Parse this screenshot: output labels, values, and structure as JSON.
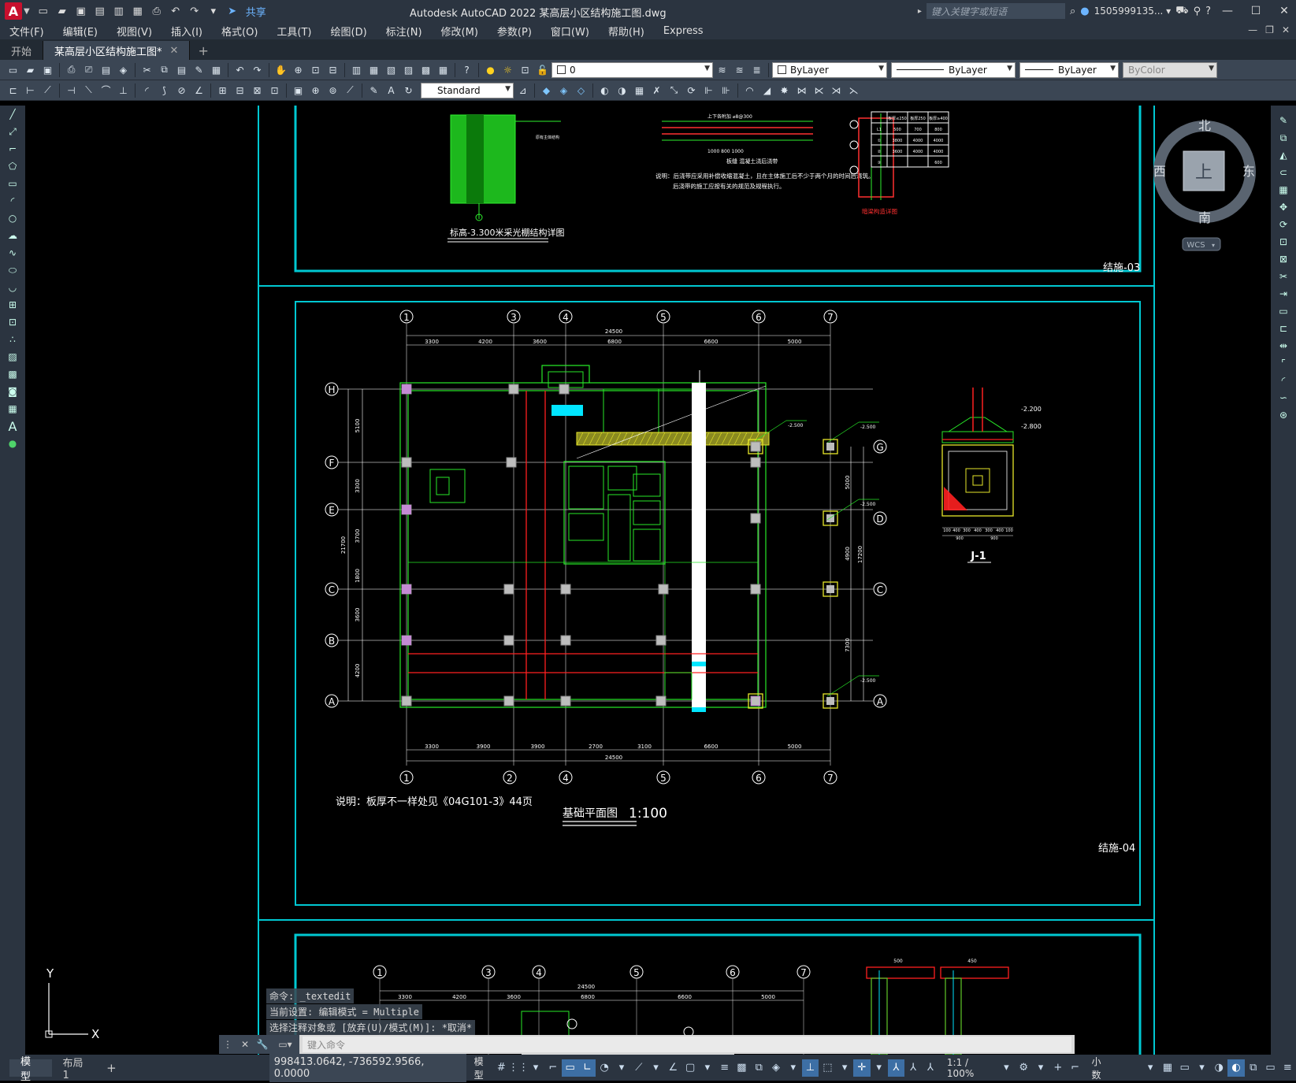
{
  "app": {
    "logo": "A",
    "title": "Autodesk AutoCAD 2022    某高层小区结构施工图.dwg",
    "share_label": "共享",
    "search_placeholder": "键入关键字或短语",
    "user": "1505999135... ▾",
    "win_min": "—",
    "win_max": "☐",
    "win_close": "✕"
  },
  "menu": {
    "items": [
      "文件(F)",
      "编辑(E)",
      "视图(V)",
      "插入(I)",
      "格式(O)",
      "工具(T)",
      "绘图(D)",
      "标注(N)",
      "修改(M)",
      "参数(P)",
      "窗口(W)",
      "帮助(H)",
      "Express"
    ],
    "right": [
      "—",
      "❐",
      "✕"
    ]
  },
  "tabs": [
    {
      "label": "开始",
      "active": false
    },
    {
      "label": "某高层小区结构施工图*",
      "active": true
    }
  ],
  "toolbar": {
    "layer": "0",
    "color": "ByLayer",
    "linetype": "ByLayer",
    "lineweight": "ByLayer",
    "plotstyle": "ByColor",
    "textstyle": "Standard"
  },
  "viewcube": {
    "north": "北",
    "south": "南",
    "west": "西",
    "east": "东",
    "top": "上",
    "wcs": "WCS"
  },
  "drawing": {
    "sheet3": {
      "title": "标高-3.300米采光棚结构详图",
      "sheet_no": "结施-03",
      "note1": "说明：后浇带应采用补偿收缩混凝土，且在主体施工后不少于两个月的时间后浇筑。",
      "note2": "后浇带的施工应按有关的规范及规程执行。",
      "caption": "板缝 混凝土浇后浇带",
      "red_caption": "暗梁构造详图",
      "table": [
        [
          "",
          "板厚≤250",
          "板厚250",
          "板厚≥400"
        ],
        [
          "L1",
          "500",
          "700",
          "800"
        ],
        [
          "①",
          "3800",
          "4000",
          "4000"
        ],
        [
          "②",
          "3600",
          "4000",
          "4000"
        ],
        [
          "③",
          "",
          "",
          "600"
        ]
      ]
    },
    "sheet4": {
      "title": "基础平面图",
      "scale": "1:100",
      "sheet_no": "结施-04",
      "note": "说明：板厚不一样处见《04G101-3》44页",
      "detail_title": "J-1",
      "axes_top": [
        "1",
        "3",
        "4",
        "5",
        "6",
        "7"
      ],
      "axes_bottom": [
        "1",
        "2",
        "4",
        "5",
        "6",
        "7"
      ],
      "axes_left": [
        "H",
        "F",
        "E",
        "C",
        "B",
        "A"
      ],
      "axes_right": [
        "G",
        "D",
        "C",
        "A"
      ],
      "dim_total": "24500",
      "dims_top": [
        "3300",
        "4200",
        "3600",
        "6800",
        "6600",
        "5000"
      ],
      "dims_bottom": [
        "3300",
        "3900",
        "3900",
        "2700",
        "3100",
        "6600",
        "5000"
      ],
      "dims_left": [
        "5100",
        "3300",
        "3700",
        "1800",
        "3600",
        "4200"
      ],
      "dim_left_total": "21700",
      "dims_right": [
        "5000",
        "4900",
        "7300"
      ],
      "dim_right_total": "17200",
      "elev_labels": [
        "-2.500",
        "-2.500",
        "-2.500",
        "-2.500",
        "-2.500"
      ],
      "detail_elev": [
        "-2.200",
        "-2.800"
      ],
      "detail_dims": [
        "100",
        "400",
        "300",
        "400",
        "300",
        "400",
        "100"
      ],
      "detail_sub": [
        "900",
        "900"
      ]
    },
    "sheet5": {
      "axes_top": [
        "1",
        "3",
        "4",
        "5",
        "6",
        "7"
      ],
      "dim_total": "24500",
      "dims_top": [
        "3300",
        "4200",
        "3600",
        "6800",
        "6600",
        "5000"
      ],
      "col_dims": [
        "500",
        "450"
      ]
    }
  },
  "ucs": {
    "y": "Y",
    "x": "X"
  },
  "command": {
    "history": [
      "命令: _textedit",
      "当前设置: 编辑模式 = Multiple",
      "选择注释对象或 [放弃(U)/模式(M)]: *取消*"
    ],
    "placeholder": "键入命令"
  },
  "status": {
    "layouts": [
      {
        "label": "模型",
        "active": true
      },
      {
        "label": "布局1",
        "active": false
      }
    ],
    "plus": "+",
    "coords": "998413.0642, -736592.9566, 0.0000",
    "model": "模型",
    "scale": "1:1 / 100%",
    "units": "小数"
  },
  "colors": {
    "frame": "#00c8d2",
    "grid": "#bdbdbd",
    "wall": "#27e827",
    "red": "#ff2020",
    "yellow": "#e6e62a",
    "cyan": "#00e5ff"
  }
}
